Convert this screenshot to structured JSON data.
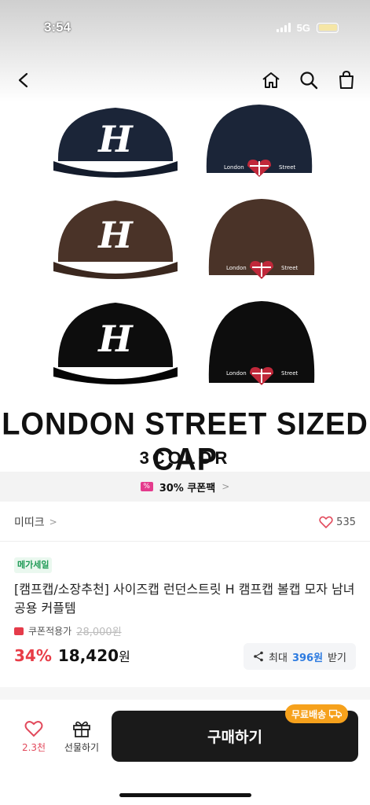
{
  "status": {
    "time": "3:54",
    "network": "5G"
  },
  "nav": {
    "back": "back-arrow",
    "icons": [
      "home-icon",
      "search-icon",
      "bag-icon"
    ]
  },
  "hero": {
    "headline": "LONDON STREET SIZED CAP",
    "sub": "3COLOR",
    "colors": {
      "navy": "#1b2538",
      "brown": "#4a3328",
      "black": "#0d0d0d"
    }
  },
  "coupon_strip": {
    "text": "30% 쿠폰팩"
  },
  "brand": {
    "name": "미띠크",
    "likes": "535"
  },
  "product": {
    "badge": "메가세일",
    "title": "[캠프캡/소장추천] 사이즈캡 런던스트릿 H 캠프캡 볼캡 모자 남녀공용 커플템",
    "coupon_label": "쿠폰적용가",
    "original_price": "28,000원",
    "discount": "34%",
    "price": "18,420",
    "currency": "원",
    "reward": {
      "prefix": "최대",
      "amount": "396원",
      "suffix": "받기"
    }
  },
  "bottom": {
    "like_count": "2.3천",
    "gift_label": "선물하기",
    "buy_label": "구매하기",
    "free_ship": "무료배송"
  }
}
